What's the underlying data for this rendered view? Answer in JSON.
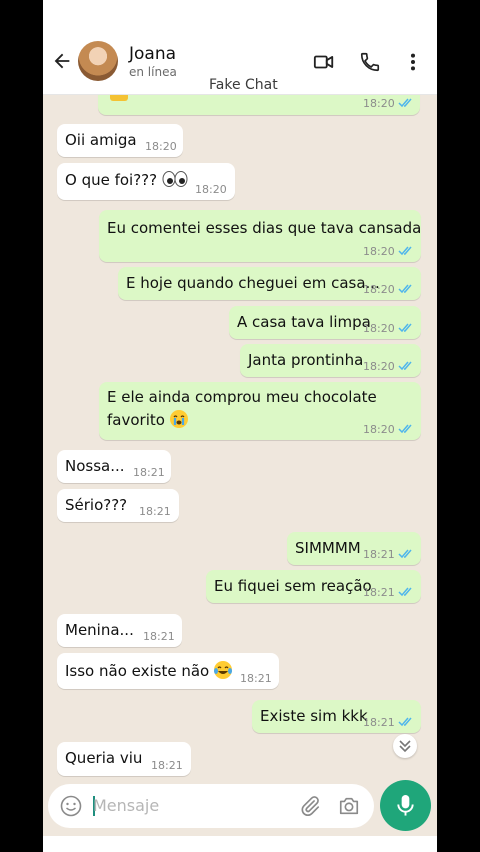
{
  "header": {
    "contact_name": "Joana",
    "presence": "en línea",
    "watermark": "Fake Chat"
  },
  "messages": [
    {
      "dir": "out",
      "text": "",
      "emoji": "folded-hands",
      "time": "18:20",
      "read": true
    },
    {
      "dir": "in",
      "text": "Oii amiga",
      "time": "18:20"
    },
    {
      "dir": "in",
      "text": "O que foi???",
      "emoji": "eyes",
      "time": "18:20"
    },
    {
      "dir": "out",
      "text": "Eu comentei esses dias que tava cansada",
      "time": "18:20",
      "read": true
    },
    {
      "dir": "out",
      "text": "E hoje quando cheguei em casa...",
      "time": "18:20",
      "read": true
    },
    {
      "dir": "out",
      "text": "A casa tava limpa",
      "time": "18:20",
      "read": true
    },
    {
      "dir": "out",
      "text": "Janta prontinha",
      "time": "18:20",
      "read": true
    },
    {
      "dir": "out",
      "line1": "E ele ainda comprou meu chocolate",
      "line2": "favorito",
      "emoji": "loudly-crying-face",
      "time": "18:20",
      "read": true
    },
    {
      "dir": "in",
      "text": "Nossa...",
      "time": "18:21"
    },
    {
      "dir": "in",
      "text": "Sério???",
      "time": "18:21"
    },
    {
      "dir": "out",
      "text": "SIMMMM",
      "time": "18:21",
      "read": true
    },
    {
      "dir": "out",
      "text": "Eu fiquei sem reação",
      "time": "18:21",
      "read": true
    },
    {
      "dir": "in",
      "text": "Menina...",
      "time": "18:21"
    },
    {
      "dir": "in",
      "text": "Isso não existe não",
      "emoji": "tears-of-joy",
      "time": "18:21"
    },
    {
      "dir": "out",
      "text": "Existe sim kkk",
      "time": "18:21",
      "read": true
    },
    {
      "dir": "in",
      "text": "Queria viu",
      "time": "18:21"
    }
  ],
  "composer": {
    "placeholder": "Mensaje"
  },
  "icons": {
    "back": "back-arrow-icon",
    "video": "video-call-icon",
    "call": "phone-call-icon",
    "menu": "more-vert-icon",
    "emoji": "emoji-icon",
    "attach": "attach-icon",
    "camera": "camera-icon",
    "mic": "mic-icon",
    "scroll": "chevron-double-down-icon"
  },
  "colors": {
    "outgoing": "#dcf8c6",
    "incoming": "#ffffff",
    "background": "#efe7dd",
    "accent": "#1fa67a",
    "read_tick": "#4fb5ec"
  }
}
